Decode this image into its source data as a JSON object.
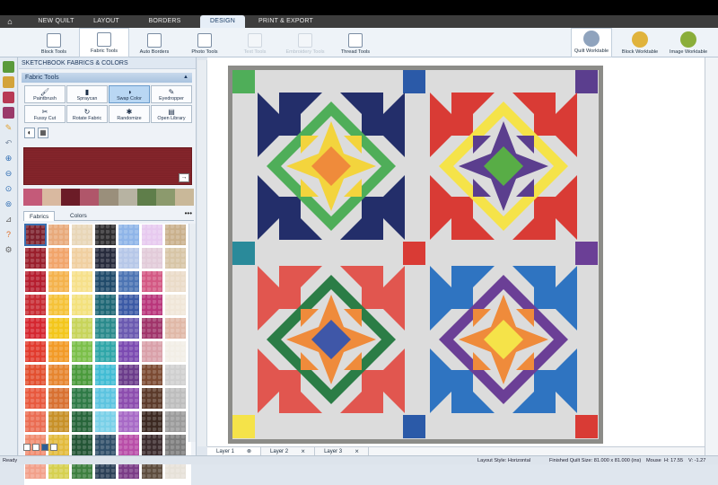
{
  "tabs": [
    "NEW QUILT",
    "LAYOUT",
    "BORDERS",
    "DESIGN",
    "PRINT & EXPORT"
  ],
  "active_tab": "DESIGN",
  "ribbon": [
    {
      "label": "Block Tools",
      "state": "normal"
    },
    {
      "label": "Fabric Tools",
      "state": "active"
    },
    {
      "label": "Auto Borders",
      "state": "normal"
    },
    {
      "label": "Photo Tools",
      "state": "normal"
    },
    {
      "label": "Text Tools",
      "state": "disabled"
    },
    {
      "label": "Embroidery Tools",
      "state": "disabled"
    },
    {
      "label": "Thread Tools",
      "state": "normal"
    }
  ],
  "worktables": [
    {
      "label": "Quilt Worktable",
      "color": "#8fa3bd"
    },
    {
      "label": "Block Worktable",
      "color": "#e0b33c"
    },
    {
      "label": "Image Worktable",
      "color": "#8aae3a"
    }
  ],
  "panel": {
    "title": "SKETCHBOOK FABRICS & COLORS",
    "tools_header": "Fabric Tools",
    "tools": [
      {
        "label": "Paintbrush",
        "icon": "paintbrush-icon",
        "glyph": "🖌",
        "active": false
      },
      {
        "label": "Spraycan",
        "icon": "spraycan-icon",
        "glyph": "▮",
        "active": false
      },
      {
        "label": "Swap Color",
        "icon": "swap-color-icon",
        "glyph": "◑",
        "active": true
      },
      {
        "label": "Eyedropper",
        "icon": "eyedropper-icon",
        "glyph": "✎",
        "active": false
      },
      {
        "label": "Fussy Cut",
        "icon": "fussy-cut-icon",
        "glyph": "✂",
        "active": false
      },
      {
        "label": "Rotate Fabric",
        "icon": "rotate-fabric-icon",
        "glyph": "↻",
        "active": false
      },
      {
        "label": "Randomize",
        "icon": "randomize-icon",
        "glyph": "✱",
        "active": false
      },
      {
        "label": "Open Library",
        "icon": "open-library-icon",
        "glyph": "▤",
        "active": false
      }
    ],
    "fabric_tab": "Fabrics",
    "colors_tab": "Colors",
    "more": "•••",
    "recent_colors": [
      "#c45a79",
      "#d9b9a0",
      "#6b1c27",
      "#b0566a",
      "#9a8f7b",
      "#b7b3a2",
      "#5f7e4a",
      "#8c9a6d",
      "#c9b899"
    ],
    "fabrics": [
      "#7b1f2b",
      "#e8a97a",
      "#e8d6b7",
      "#2d2c2e",
      "#8eb4e8",
      "#e7c9ef",
      "#c9b08c",
      "#9a1e2b",
      "#f1a46a",
      "#f0cfa0",
      "#262a3c",
      "#b6c7e8",
      "#e2cbd9",
      "#d7c5a6",
      "#b51d2e",
      "#f4b24c",
      "#f6e08a",
      "#204a6a",
      "#4c74b3",
      "#d35883",
      "#eadbc8",
      "#c72a32",
      "#f5c238",
      "#f3e17c",
      "#1e6775",
      "#3a59a5",
      "#b9357b",
      "#f0e6d8",
      "#d5262f",
      "#f3c61a",
      "#c7d45a",
      "#2a8a8c",
      "#6a59b0",
      "#a0346a",
      "#e0b8a7",
      "#e13a2d",
      "#f29a26",
      "#7bbf49",
      "#2fa6a8",
      "#7b4ab1",
      "#d9a0a9",
      "#f2eee6",
      "#e24f2f",
      "#e6852e",
      "#4a9a3b",
      "#41bcd4",
      "#6a3b8a",
      "#7b4a32",
      "#cfcfcf",
      "#e8583d",
      "#d87030",
      "#2e7a46",
      "#5cc4e0",
      "#8c4cae",
      "#5b3a2a",
      "#bdbdbd",
      "#ea6c52",
      "#c79027",
      "#27653a",
      "#79d0e8",
      "#a769c6",
      "#3b2820",
      "#9b9b9b",
      "#f08a6d",
      "#e2ba3a",
      "#225434",
      "#2f4e68",
      "#b84ca7",
      "#3a2a2c",
      "#7c7c7c",
      "#f2a08a",
      "#d6d04f",
      "#3c7f3e",
      "#2b4057",
      "#7a3b86",
      "#5d4c3d",
      "#e6e1d8"
    ]
  },
  "layers": [
    "Layer 1",
    "Layer 2",
    "Layer 3"
  ],
  "status": {
    "left": "Ready",
    "layout_style": "Layout Style: Horizontal",
    "finished": "Finished Quilt Size: 81.000 x 81.000 (ins)",
    "mouse": "Mouse",
    "h": "H: 17.55",
    "v": "V: -1.27"
  },
  "quilt_colors": {
    "background": "#dcdcdc",
    "border": "#8c8c88",
    "blocks": [
      {
        "outer": "#232e6a",
        "ring": "#4fae59",
        "center": "#ef8b3b",
        "inner": "#f3d43d"
      },
      {
        "outer": "#d93b35",
        "ring": "#f5e349",
        "center": "#58ad46",
        "inner": "#5b3e8e"
      },
      {
        "outer": "#e1564f",
        "ring": "#2b7d46",
        "center": "#3f57a8",
        "inner": "#ef8b3b"
      },
      {
        "outer": "#2f74c1",
        "ring": "#6b3f96",
        "center": "#f5e349",
        "inner": "#ef8b3b"
      }
    ],
    "cornerstones": [
      "#4fae59",
      "#2b5aa8",
      "#5b3e8e",
      "#2a8a9a",
      "#d93b35",
      "#6b3f96",
      "#f5e349",
      "#2b5aa8",
      "#d93b35"
    ]
  }
}
